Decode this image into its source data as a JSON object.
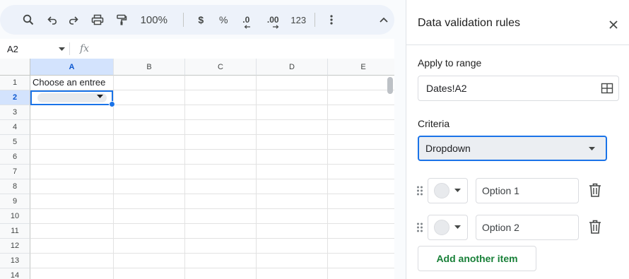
{
  "toolbar": {
    "zoom": "100%",
    "currency": "$",
    "percent": "%",
    "decrease_decimal": ".0",
    "increase_decimal": ".00",
    "number_format": "123",
    "icons": [
      "search-icon",
      "undo-icon",
      "redo-icon",
      "print-icon",
      "paint-format-icon",
      "more-vert-icon",
      "collapse-toolbar-icon"
    ]
  },
  "formula_bar": {
    "cell_ref": "A2",
    "fx": "fx"
  },
  "sheet": {
    "columns": [
      "A",
      "B",
      "C",
      "D",
      "E"
    ],
    "rows": [
      "1",
      "2",
      "3",
      "4",
      "5",
      "6",
      "7",
      "8",
      "9",
      "10",
      "11",
      "12",
      "13",
      "14"
    ],
    "selected_col": "A",
    "selected_row": "2",
    "cells": {
      "A1": "Choose an entree"
    }
  },
  "panel": {
    "title": "Data validation rules",
    "apply_label": "Apply to range",
    "range_value": "Dates!A2",
    "criteria_label": "Criteria",
    "criteria_value": "Dropdown",
    "options": [
      {
        "placeholder": "Option 1"
      },
      {
        "placeholder": "Option 2"
      }
    ],
    "add_item": "Add another item"
  },
  "colors": {
    "accent": "#1a73e8",
    "add_button": "#188038"
  }
}
